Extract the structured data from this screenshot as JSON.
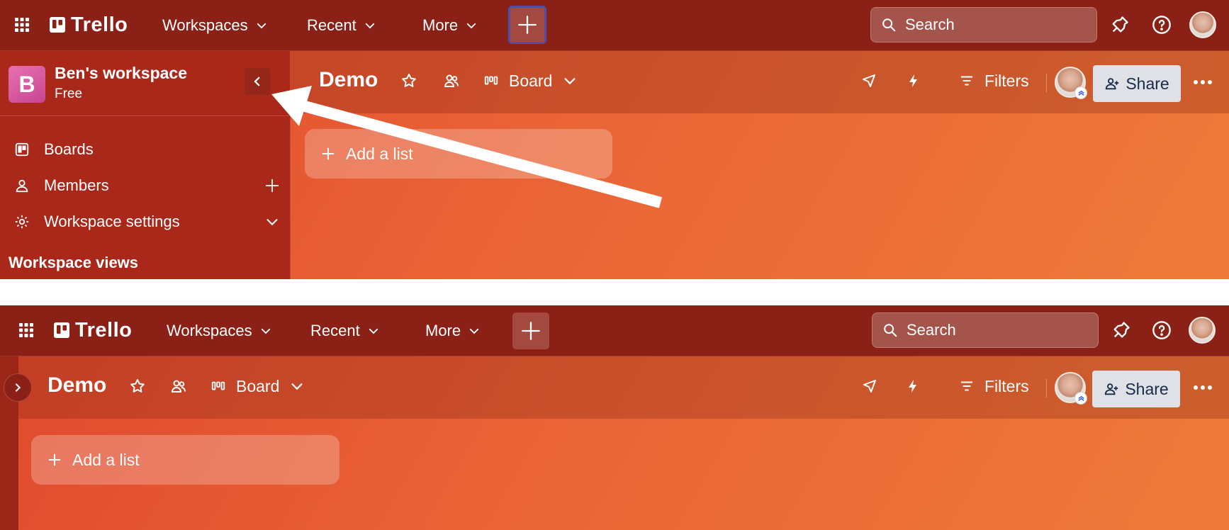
{
  "colors": {
    "nav_bg": "#8a2016",
    "sidebar_bg": "#a92819",
    "board_gradient_start": "#e04a2e",
    "board_gradient_end": "#ee7a3a",
    "share_button_bg": "#dfe1e6",
    "workspace_badge": "#d9559f",
    "create_button_focus_ring": "#4b4fb0"
  },
  "topnav": {
    "apps_icon": "grid-apps-icon",
    "logo_text": "Trello",
    "menus": [
      {
        "label": "Workspaces"
      },
      {
        "label": "Recent"
      },
      {
        "label": "More"
      }
    ],
    "create_icon": "plus-icon",
    "search_placeholder": "Search",
    "notifications_icon": "bell-icon",
    "help_icon": "help-circle-icon",
    "avatar_icon": "user-avatar"
  },
  "sidebar": {
    "workspace_initial": "B",
    "workspace_name": "Ben's workspace",
    "workspace_plan": "Free",
    "items": [
      {
        "label": "Boards",
        "icon": "board-icon"
      },
      {
        "label": "Members",
        "icon": "person-icon",
        "trailing": "plus-icon"
      },
      {
        "label": "Workspace settings",
        "icon": "gear-icon",
        "trailing": "chevron-down-icon"
      }
    ],
    "section_title": "Workspace views"
  },
  "board": {
    "title": "Demo",
    "view_label": "Board",
    "filters_label": "Filters",
    "share_label": "Share",
    "add_list_label": "Add a list"
  }
}
